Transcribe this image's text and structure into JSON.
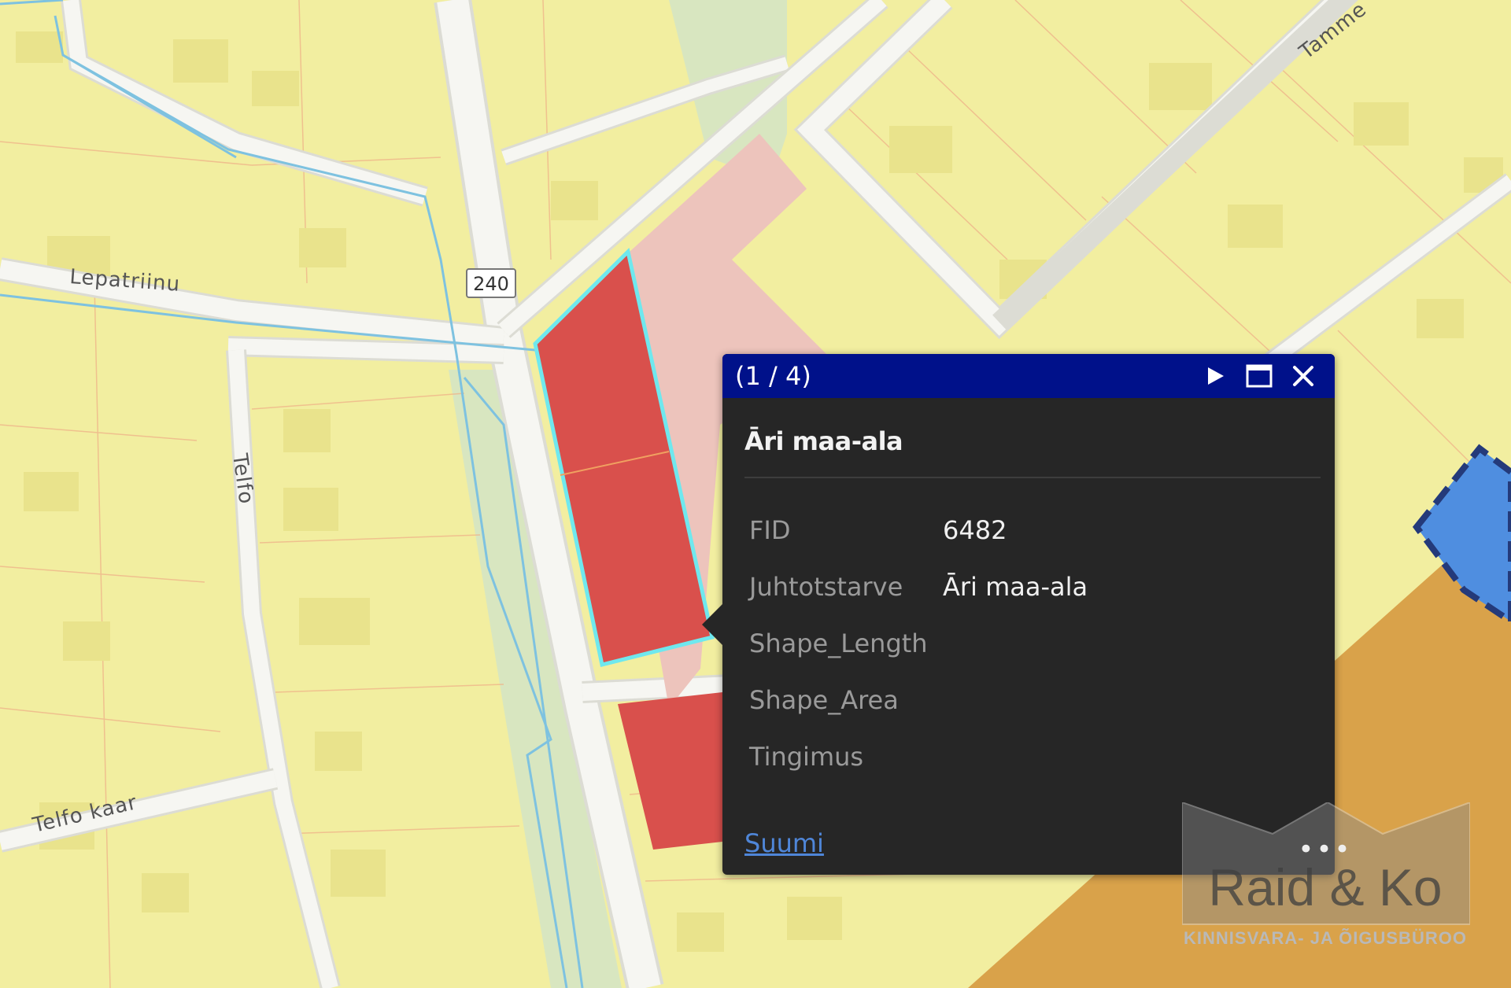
{
  "map": {
    "street_labels": {
      "lepatriinu": "Lepatriinu",
      "telfo": "Telfo",
      "telfo_kaar": "Telfo kaar",
      "tamme": "Tamme"
    },
    "road_shield": "240",
    "colors": {
      "residential": "#f2eea0",
      "road": "#f0f0ea",
      "commercial": "#d9504c",
      "commercial_light": "#edc4bc",
      "selection_outline": "#6fe8ee",
      "green": "#d8e6c0",
      "water_line": "#7ec2e0",
      "orange_zone": "#d9a24a",
      "blue_zone": "#4f8ee0"
    }
  },
  "popup": {
    "counter": "(1 / 4)",
    "title": "Āri maa-ala",
    "attributes": [
      {
        "key": "FID",
        "value": "6482"
      },
      {
        "key": "Juhtotstarve",
        "value": "Āri maa-ala"
      },
      {
        "key": "Shape_Length",
        "value": ""
      },
      {
        "key": "Shape_Area",
        "value": ""
      },
      {
        "key": "Tingimus",
        "value": ""
      }
    ],
    "zoom_link": "Suumi",
    "icons": {
      "next": "play-icon",
      "maximize": "maximize-icon",
      "close": "close-icon"
    },
    "header_color": "#00118a"
  },
  "watermark": {
    "dots": "•••",
    "name": "Raid & Ko",
    "subtitle": "KINNISVARA- JA ÕIGUSBÜROO"
  }
}
